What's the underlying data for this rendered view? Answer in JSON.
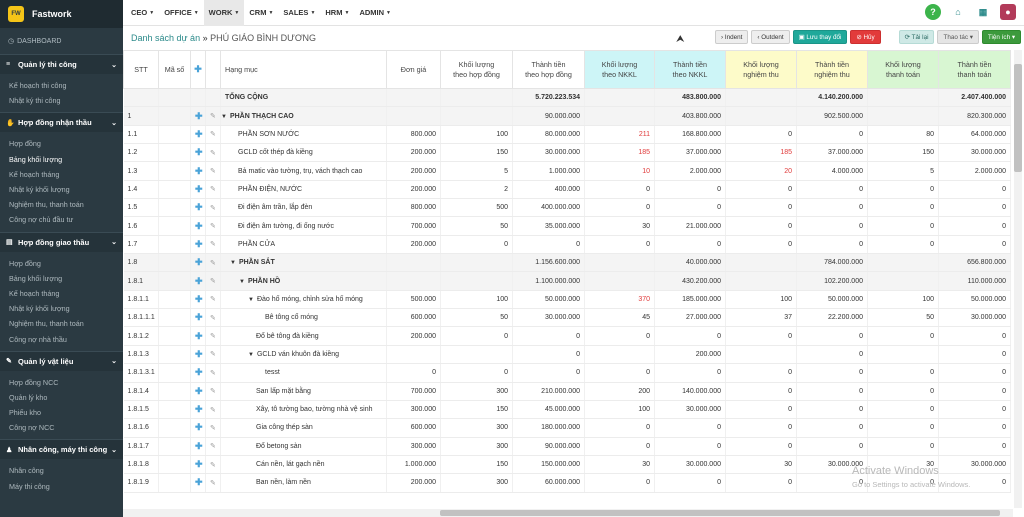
{
  "app": {
    "logo_text": "FW",
    "name": "Fastwork"
  },
  "sidebar": {
    "dashboard": "DASHBOARD",
    "sections": [
      {
        "title": "Quản lý thi công",
        "icon": "layers-icon",
        "items": [
          "Kế hoạch thi công",
          "Nhật ký thi công"
        ]
      },
      {
        "title": "Hợp đồng nhận thầu",
        "icon": "handshake-icon",
        "items": [
          "Hợp đồng",
          "Bảng khối lượng",
          "Kế hoạch tháng",
          "Nhật ký khối lượng",
          "Nghiệm thu, thanh toán",
          "Công nợ chủ đầu tư"
        ]
      },
      {
        "title": "Hợp đồng giao thầu",
        "icon": "doc-icon",
        "items": [
          "Hợp đồng",
          "Bảng khối lượng",
          "Kế hoạch tháng",
          "Nhật ký khối lượng",
          "Nghiệm thu, thanh toán",
          "Công nợ nhà thầu"
        ]
      },
      {
        "title": "Quản lý vật liệu",
        "icon": "wrench-icon",
        "items": [
          "Hợp đồng NCC",
          "Quản lý kho",
          "Phiếu kho",
          "Công nợ NCC"
        ]
      },
      {
        "title": "Nhân công, máy thi công",
        "icon": "users-icon",
        "items": [
          "Nhân công",
          "Máy thi công"
        ]
      }
    ]
  },
  "topbar": {
    "menus": [
      "CEO",
      "OFFICE",
      "WORK",
      "CRM",
      "SALES",
      "HRM",
      "ADMIN"
    ],
    "active_menu": "WORK"
  },
  "breadcrumb": {
    "parent": "Danh sách dự án",
    "sep": "»",
    "current": "PHÚ GIÁO BÌNH DƯƠNG"
  },
  "toolbar": {
    "indent": "Indent",
    "outdent": "Outdent",
    "save": "Lưu thay đổi",
    "cancel": "Hủy",
    "reload": "Tải lại",
    "actions": "Thao tác",
    "utilities": "Tiện ích"
  },
  "table": {
    "headers": {
      "stt": "STT",
      "ma_so": "Mã số",
      "hang_muc": "Hạng mục",
      "don_gia": "Đơn giá",
      "kl_hd": [
        "Khối lượng",
        "theo hợp đồng"
      ],
      "tt_hd": [
        "Thành tiền",
        "theo hợp đồng"
      ],
      "kl_nkkl": [
        "Khối lượng",
        "theo NKKL"
      ],
      "tt_nkkl": [
        "Thành tiền",
        "theo NKKL"
      ],
      "kl_nt": [
        "Khối lượng",
        "nghiệm thu"
      ],
      "tt_nt": [
        "Thành tiền",
        "nghiệm thu"
      ],
      "kl_tt": [
        "Khối lượng",
        "thanh toán"
      ],
      "tt_tt": [
        "Thành tiền",
        "thanh toán"
      ]
    },
    "total": {
      "label": "TỔNG CỘNG",
      "tt_hd": "5.720.223.534",
      "tt_nkkl": "483.800.000",
      "tt_nt": "4.140.200.000",
      "tt_tt": "2.407.400.000"
    },
    "rows": [
      {
        "stt": "1",
        "level": 0,
        "group": true,
        "name": "PHẦN THẠCH CAO",
        "don_gia": "",
        "kl_hd": "",
        "tt_hd": "90.000.000",
        "kl_nkkl": "",
        "tt_nkkl": "403.800.000",
        "kl_nt": "",
        "tt_nt": "902.500.000",
        "kl_tt": "",
        "tt_tt": "820.300.000"
      },
      {
        "stt": "1.1",
        "level": 1,
        "name": "PHẦN SƠN NƯỚC",
        "don_gia": "800.000",
        "kl_hd": "100",
        "tt_hd": "80.000.000",
        "kl_nkkl": "211",
        "red_nkkl": true,
        "tt_nkkl": "168.800.000",
        "kl_nt": "0",
        "tt_nt": "0",
        "kl_tt": "80",
        "tt_tt": "64.000.000"
      },
      {
        "stt": "1.2",
        "level": 1,
        "name": "GCLD cốt thép đà kiềng",
        "don_gia": "200.000",
        "kl_hd": "150",
        "tt_hd": "30.000.000",
        "kl_nkkl": "185",
        "red_nkkl": true,
        "tt_nkkl": "37.000.000",
        "kl_nt": "185",
        "red_nt": true,
        "tt_nt": "37.000.000",
        "kl_tt": "150",
        "tt_tt": "30.000.000"
      },
      {
        "stt": "1.3",
        "level": 1,
        "name": "Bả matic vào tường, trụ, vách thạch cao",
        "don_gia": "200.000",
        "kl_hd": "5",
        "tt_hd": "1.000.000",
        "kl_nkkl": "10",
        "red_nkkl": true,
        "tt_nkkl": "2.000.000",
        "kl_nt": "20",
        "red_nt": true,
        "tt_nt": "4.000.000",
        "kl_tt": "5",
        "tt_tt": "2.000.000"
      },
      {
        "stt": "1.4",
        "level": 1,
        "name": "PHẦN ĐIỆN, NƯỚC",
        "don_gia": "200.000",
        "kl_hd": "2",
        "tt_hd": "400.000",
        "kl_nkkl": "0",
        "tt_nkkl": "0",
        "kl_nt": "0",
        "tt_nt": "0",
        "kl_tt": "0",
        "tt_tt": "0"
      },
      {
        "stt": "1.5",
        "level": 1,
        "name": "Đi điện âm trần, lắp đèn",
        "don_gia": "800.000",
        "kl_hd": "500",
        "tt_hd": "400.000.000",
        "kl_nkkl": "0",
        "tt_nkkl": "0",
        "kl_nt": "0",
        "tt_nt": "0",
        "kl_tt": "0",
        "tt_tt": "0"
      },
      {
        "stt": "1.6",
        "level": 1,
        "name": "Đi điện âm tường, đi ống nước",
        "don_gia": "700.000",
        "kl_hd": "50",
        "tt_hd": "35.000.000",
        "kl_nkkl": "30",
        "tt_nkkl": "21.000.000",
        "kl_nt": "0",
        "tt_nt": "0",
        "kl_tt": "0",
        "tt_tt": "0"
      },
      {
        "stt": "1.7",
        "level": 1,
        "name": "PHẦN CỬA",
        "don_gia": "200.000",
        "kl_hd": "0",
        "tt_hd": "0",
        "kl_nkkl": "0",
        "tt_nkkl": "0",
        "kl_nt": "0",
        "tt_nt": "0",
        "kl_tt": "0",
        "tt_tt": "0"
      },
      {
        "stt": "1.8",
        "level": 1,
        "group": true,
        "name": "PHẦN SẮT",
        "don_gia": "",
        "kl_hd": "",
        "tt_hd": "1.156.600.000",
        "kl_nkkl": "",
        "tt_nkkl": "40.000.000",
        "kl_nt": "",
        "tt_nt": "784.000.000",
        "kl_tt": "",
        "tt_tt": "656.800.000"
      },
      {
        "stt": "1.8.1",
        "level": 2,
        "group": true,
        "name": "PHẦN HỒ",
        "don_gia": "",
        "kl_hd": "",
        "tt_hd": "1.100.000.000",
        "kl_nkkl": "",
        "tt_nkkl": "430.200.000",
        "kl_nt": "",
        "tt_nt": "102.200.000",
        "kl_tt": "",
        "tt_tt": "110.000.000"
      },
      {
        "stt": "1.8.1.1",
        "level": 3,
        "caret": true,
        "name": "Đào hố móng, chỉnh sửa hố móng",
        "don_gia": "500.000",
        "kl_hd": "100",
        "tt_hd": "50.000.000",
        "kl_nkkl": "370",
        "red_nkkl": true,
        "tt_nkkl": "185.000.000",
        "kl_nt": "100",
        "tt_nt": "50.000.000",
        "kl_tt": "100",
        "tt_tt": "50.000.000"
      },
      {
        "stt": "1.8.1.1.1",
        "level": 4,
        "name": "Bê tông cổ móng",
        "don_gia": "600.000",
        "kl_hd": "50",
        "tt_hd": "30.000.000",
        "kl_nkkl": "45",
        "tt_nkkl": "27.000.000",
        "kl_nt": "37",
        "tt_nt": "22.200.000",
        "kl_tt": "50",
        "tt_tt": "30.000.000"
      },
      {
        "stt": "1.8.1.2",
        "level": 3,
        "name": "Đổ bê tông đà kiềng",
        "don_gia": "200.000",
        "kl_hd": "0",
        "tt_hd": "0",
        "kl_nkkl": "0",
        "tt_nkkl": "0",
        "kl_nt": "0",
        "tt_nt": "0",
        "kl_tt": "0",
        "tt_tt": "0"
      },
      {
        "stt": "1.8.1.3",
        "level": 3,
        "caret": true,
        "name": "GCLD ván khuôn đà kiềng",
        "don_gia": "",
        "kl_hd": "",
        "tt_hd": "0",
        "kl_nkkl": "",
        "tt_nkkl": "200.000",
        "kl_nt": "",
        "tt_nt": "0",
        "kl_tt": "",
        "tt_tt": "0"
      },
      {
        "stt": "1.8.1.3.1",
        "level": 4,
        "name": "tesst",
        "don_gia": "0",
        "kl_hd": "0",
        "tt_hd": "0",
        "kl_nkkl": "0",
        "tt_nkkl": "0",
        "kl_nt": "0",
        "tt_nt": "0",
        "kl_tt": "0",
        "tt_tt": "0"
      },
      {
        "stt": "1.8.1.4",
        "level": 3,
        "name": "San lấp mặt bằng",
        "don_gia": "700.000",
        "kl_hd": "300",
        "tt_hd": "210.000.000",
        "kl_nkkl": "200",
        "tt_nkkl": "140.000.000",
        "kl_nt": "0",
        "tt_nt": "0",
        "kl_tt": "0",
        "tt_tt": "0"
      },
      {
        "stt": "1.8.1.5",
        "level": 3,
        "name": "Xây, tô tường bao, tường nhà vệ sinh",
        "don_gia": "300.000",
        "kl_hd": "150",
        "tt_hd": "45.000.000",
        "kl_nkkl": "100",
        "tt_nkkl": "30.000.000",
        "kl_nt": "0",
        "tt_nt": "0",
        "kl_tt": "0",
        "tt_tt": "0"
      },
      {
        "stt": "1.8.1.6",
        "level": 3,
        "name": "Gia công thép sàn",
        "don_gia": "600.000",
        "kl_hd": "300",
        "tt_hd": "180.000.000",
        "kl_nkkl": "0",
        "tt_nkkl": "0",
        "kl_nt": "0",
        "tt_nt": "0",
        "kl_tt": "0",
        "tt_tt": "0"
      },
      {
        "stt": "1.8.1.7",
        "level": 3,
        "name": "Đổ betong sàn",
        "don_gia": "300.000",
        "kl_hd": "300",
        "tt_hd": "90.000.000",
        "kl_nkkl": "0",
        "tt_nkkl": "0",
        "kl_nt": "0",
        "tt_nt": "0",
        "kl_tt": "0",
        "tt_tt": "0"
      },
      {
        "stt": "1.8.1.8",
        "level": 3,
        "name": "Cán nền, lát gạch nền",
        "don_gia": "1.000.000",
        "kl_hd": "150",
        "tt_hd": "150.000.000",
        "kl_nkkl": "30",
        "tt_nkkl": "30.000.000",
        "kl_nt": "30",
        "tt_nt": "30.000.000",
        "kl_tt": "30",
        "tt_tt": "30.000.000"
      },
      {
        "stt": "1.8.1.9",
        "level": 3,
        "name": "Ban nền, làm nền",
        "don_gia": "200.000",
        "kl_hd": "300",
        "tt_hd": "60.000.000",
        "kl_nkkl": "0",
        "tt_nkkl": "0",
        "kl_nt": "0",
        "tt_nt": "0",
        "kl_tt": "0",
        "tt_tt": "0"
      }
    ]
  },
  "watermark": {
    "line1": "Activate Windows",
    "line2": "Go to Settings to activate Windows."
  },
  "colors": {
    "sidebar": "#2b3a42",
    "accent_teal": "#2b8a8a",
    "red_value": "#e03a3a",
    "cyan_header": "#cdf5f7",
    "yellow_header": "#fdfbc9",
    "green_header": "#d8f6d2"
  }
}
